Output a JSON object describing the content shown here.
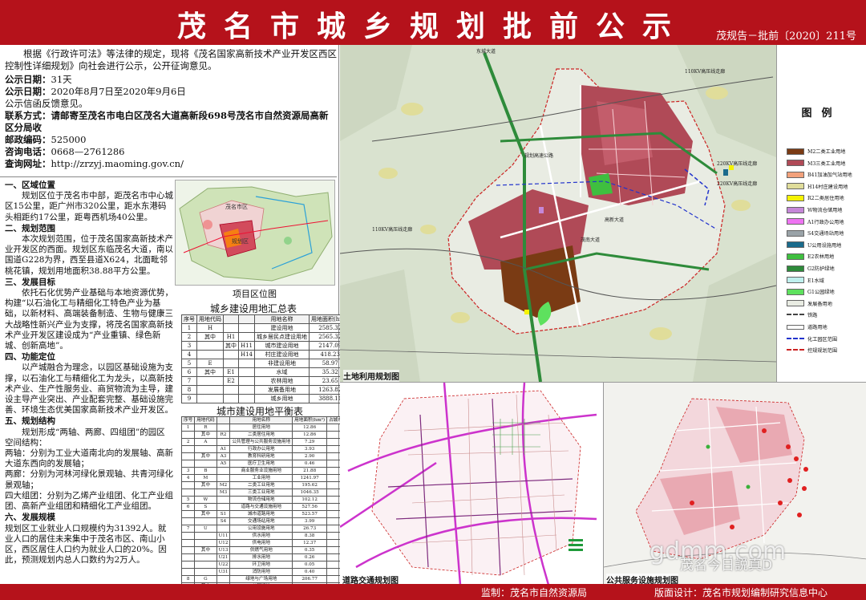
{
  "header": {
    "title": "茂名市城乡规划批前公示",
    "doc_no": "茂规告－批前〔2020〕211号"
  },
  "intro": {
    "paragraph": "根据《行政许可法》等法律的规定，现将《茂名国家高新技术产业开发区西区控制性详细规划》向社会进行公示，公开征询意见。",
    "period_label": "公示日期：",
    "period_value": "31天",
    "dates_label": "公示日期：",
    "dates_value": "2020年8月7日至2020年9月6日",
    "feedback": "公示信函反馈意见。",
    "contact_label": "联系方式：",
    "contact_value": "请邮寄至茂名市电白区茂名大道高新段698号茂名市自然资源局高新区分局收",
    "zip_label": "邮政编码：",
    "zip_value": "525000",
    "phone_label": "咨询电话：",
    "phone_value": "0668—2761286",
    "web_label": "查询网址：",
    "web_value": "http://zrzyj.maoming.gov.cn/"
  },
  "sections": [
    {
      "h": "一、区域位置",
      "t": "规划区位于茂名市中部，距茂名市中心城区15公里，距广州市320公里，距水东港码头相距约17公里，距粤西机场40公里。"
    },
    {
      "h": "二、规划范围",
      "t": "本次规划范围，位于茂名国家高新技术产业开发区的西面。规划区东临茂名大道，南以国道G228为界，西至县道X624，北面毗邻桃花镇，规划用地面积38.88平方公里。"
    },
    {
      "h": "三、发展目标",
      "t": "依托石化优势产业基础与本地资源优势，构建“以石油化工与精细化工特色产业为基础，以新材料、高端装备制造、生物与健康三大战略性新兴产业为支撑，将茂名国家高新技术产业开发区建设成为“产业重镇、绿色新城、创新高地”。"
    },
    {
      "h": "四、功能定位",
      "t": "以产城融合为理念，以园区基础设施为支撑，以石油化工与精细化工为龙头，以高新技术产业、生产性服务业、商贸物流为主导，建设主导产业突出、产业配套完整、基础设施完善、环境生态优美国家高新技术产业开发区。"
    },
    {
      "h": "五、规划结构",
      "t": "规划形成“两轴、两廊、四组团”的园区空间结构："
    },
    {
      "h": "",
      "t": "两轴：分别为工业大道南北向的发展轴、高新大道东西向的发展轴；",
      "plain": true
    },
    {
      "h": "",
      "t": "两廊：分别为河林河绿化景观轴、共青河绿化景观轴；",
      "plain": true
    },
    {
      "h": "",
      "t": "四大组团：分别为乙烯产业组团、化工产业组团、高新产业组团和精细化工产业组团。",
      "plain": true
    },
    {
      "h": "六、发展规模",
      "t": "规划区工业就业人口规模约为31392人。就业人口的居住未来集中于茂名市区、南山小区，西区居住人口约为就业人口的20%。因此，预测规划内总人口数约为2万人。",
      "plain": true
    }
  ],
  "location_map": {
    "caption": "项目区位图",
    "label_a": "茂名市区",
    "label_b": "规划区"
  },
  "table1": {
    "title": "城乡建设用地汇总表",
    "headers": [
      "序号",
      "用地代码",
      "",
      "",
      "用地名称",
      "用地面积(hm²)",
      "占城乡用地比例(%)"
    ],
    "rows": [
      [
        "1",
        "H",
        "",
        "",
        "建设用地",
        "2585.32",
        "65.98"
      ],
      [
        "2",
        "其中",
        "H1",
        "",
        "城乡居民点建设用地",
        "2565.32",
        "65.98"
      ],
      [
        "3",
        "",
        "其中",
        "H11",
        "城市建设用地",
        "2147.09",
        "55.22"
      ],
      [
        "4",
        "",
        "",
        "H14",
        "村庄建设用地",
        "418.23",
        "10.76"
      ],
      [
        "5",
        "E",
        "",
        "",
        "非建设用地",
        "58.97",
        "1.52"
      ],
      [
        "6",
        "其中",
        "E1",
        "",
        "水域",
        "35.32",
        "0.91"
      ],
      [
        "7",
        "",
        "E2",
        "",
        "农林用地",
        "23.65",
        "0.61"
      ],
      [
        "8",
        "",
        "",
        "",
        "发展备用地",
        "1263.82",
        "32.5"
      ],
      [
        "9",
        "",
        "",
        "",
        "城乡用地",
        "3888.11",
        "100"
      ]
    ]
  },
  "table2": {
    "title": "城市建设用地平衡表",
    "headers": [
      "序号",
      "用地代码",
      "",
      "用地名称",
      "用地面积(hm²)",
      "占城市建设用地比例(%)"
    ],
    "rows": [
      [
        "1",
        "R",
        "",
        "居住用地",
        "12.86",
        "0.6"
      ],
      [
        "",
        "其中",
        "R2",
        "二类居住用地",
        "12.86",
        "0.6"
      ],
      [
        "2",
        "A",
        "",
        "公共管理与公共服务设施用地",
        "7.29",
        "0.34"
      ],
      [
        "",
        "",
        "A1",
        "行政办公用地",
        "3.93",
        "0.18"
      ],
      [
        "",
        "其中",
        "A3",
        "教育科研用地",
        "2.90",
        "0.14"
      ],
      [
        "",
        "",
        "A5",
        "医疗卫生用地",
        "0.46",
        "0.02"
      ],
      [
        "3",
        "B",
        "",
        "商业服务业设施用地",
        "21.88",
        "1.02"
      ],
      [
        "4",
        "M",
        "",
        "工业用地",
        "1241.97",
        "57.84"
      ],
      [
        "",
        "其中",
        "M2",
        "二类工业用地",
        "195.62",
        "9.11"
      ],
      [
        "",
        "",
        "M3",
        "三类工业用地",
        "1046.35",
        "48.73"
      ],
      [
        "5",
        "W",
        "",
        "物流仓储用地",
        "102.12",
        "4.76"
      ],
      [
        "6",
        "S",
        "",
        "道路与交通设施用地",
        "527.56",
        "24.57"
      ],
      [
        "",
        "其中",
        "S1",
        "城市道路用地",
        "523.57",
        "24.39"
      ],
      [
        "",
        "",
        "S4",
        "交通场站用地",
        "3.99",
        "0.19"
      ],
      [
        "7",
        "U",
        "",
        "公用设施用地",
        "26.73",
        "1.24"
      ],
      [
        "",
        "",
        "U11",
        "供水用地",
        "8.38",
        "0.39"
      ],
      [
        "",
        "",
        "U12",
        "供电用地",
        "12.37",
        "0.58"
      ],
      [
        "",
        "其中",
        "U13",
        "供燃气用地",
        "0.35",
        "0.02"
      ],
      [
        "",
        "",
        "U21",
        "排水用地",
        "0.26",
        "0.01"
      ],
      [
        "",
        "",
        "U22",
        "环卫用地",
        "0.05",
        "0.00"
      ],
      [
        "",
        "",
        "U31",
        "消防用地",
        "0.40",
        "0.02"
      ],
      [
        "8",
        "G",
        "",
        "绿地与广场用地",
        "206.77",
        "9.63"
      ],
      [
        "",
        "其中",
        "G1",
        "公园绿地",
        "38.50",
        "1.79"
      ],
      [
        "",
        "",
        "G2",
        "防护绿地",
        "168.27",
        "7.84"
      ],
      [
        "9",
        "H11",
        "",
        "城市建设用地",
        "2147.09",
        "100"
      ]
    ]
  },
  "main_map": {
    "caption": "土地利用规划图",
    "labels": [
      "东城大道",
      "110KV高压线走廊",
      "220KV高压线走廊",
      "110KV高压线走廊",
      "规划高速公路",
      "高新大道",
      "茂南大道",
      "220KV高压线走廊"
    ]
  },
  "legend": {
    "title": "图例",
    "items": [
      {
        "label": "M2二类工业用地",
        "color": "#7a3b14"
      },
      {
        "label": "M3三类工业用地",
        "color": "#b04a57"
      },
      {
        "label": "B41加油加气站用地",
        "color": "#f2a17b"
      },
      {
        "label": "H14村庄建设用地",
        "color": "#e0dd9a"
      },
      {
        "label": "R2二类居住用地",
        "color": "#f5f300"
      },
      {
        "label": "W物流仓储用地",
        "color": "#c587d8"
      },
      {
        "label": "A1行政办公用地",
        "color": "#ee74f2"
      },
      {
        "label": "S4交通场站用地",
        "color": "#9aa3a8"
      },
      {
        "label": "U公用设施用地",
        "color": "#1a6b8c"
      },
      {
        "label": "E2农林用地",
        "color": "#3fbf3f"
      },
      {
        "label": "G2防护绿地",
        "color": "#2e8b3a"
      },
      {
        "label": "E1水域",
        "color": "#bff0ee"
      },
      {
        "label": "G1公园绿地",
        "color": "#5ee15e"
      },
      {
        "label": "发展备用地",
        "color": "#e9ece3"
      },
      {
        "label": "铁路",
        "color": "#444444"
      },
      {
        "label": "道路用地",
        "color": "#ffffff"
      },
      {
        "label": "化工园区范围",
        "color": "#2233cc"
      },
      {
        "label": "控规规划范围",
        "color": "#cc2222"
      }
    ]
  },
  "road_map": {
    "caption": "道路交通规划图"
  },
  "pub_map": {
    "caption": "公共服务设施规划图"
  },
  "footer": {
    "supervisor": "监制：茂名市自然资源局",
    "unit": "版面设计：茂名市规划编制研究信息中心"
  },
  "watermark": {
    "site": "gdmm.com",
    "account": "茂名今日説真D"
  }
}
